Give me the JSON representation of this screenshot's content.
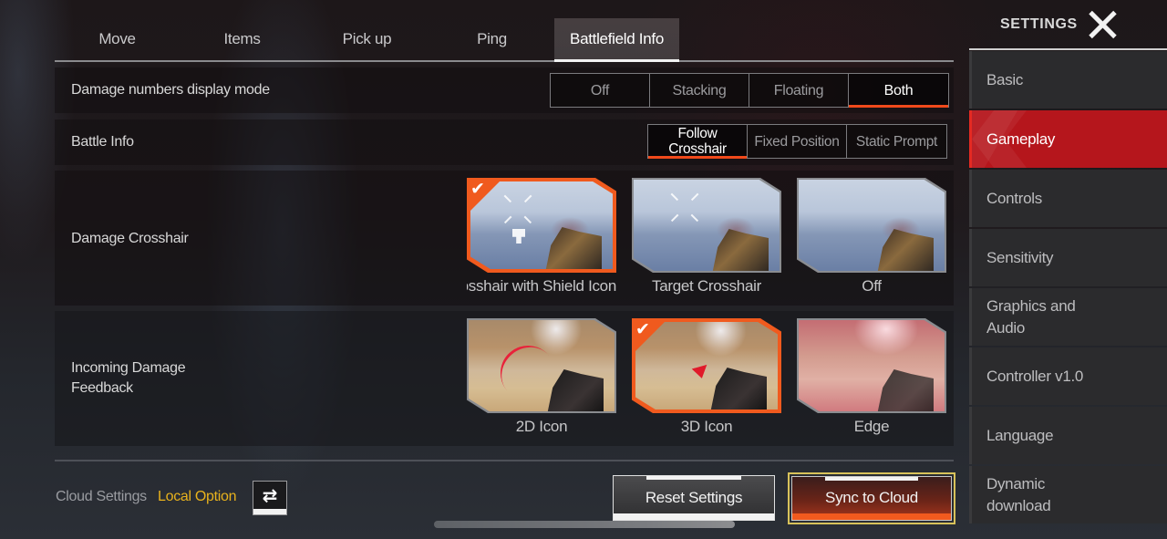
{
  "tabs": [
    {
      "label": "Move",
      "active": false
    },
    {
      "label": "Items",
      "active": false
    },
    {
      "label": "Pick up",
      "active": false
    },
    {
      "label": "Ping",
      "active": false
    },
    {
      "label": "Battlefield Info",
      "active": true
    }
  ],
  "settings": {
    "damage_numbers": {
      "label": "Damage numbers display mode",
      "options": [
        "Off",
        "Stacking",
        "Floating",
        "Both"
      ],
      "selected": "Both"
    },
    "battle_info": {
      "label": "Battle Info",
      "options": [
        "Follow Crosshair",
        "Fixed Position",
        "Static Prompt"
      ],
      "selected": "Follow Crosshair"
    },
    "damage_crosshair": {
      "label": "Damage Crosshair",
      "options": [
        {
          "label": "Crosshair with Shield Icon",
          "visible_label": "rosshair with Shield Ic",
          "selected": true,
          "icon": "check-icon"
        },
        {
          "label": "Target Crosshair",
          "selected": false
        },
        {
          "label": "Off",
          "selected": false
        }
      ]
    },
    "incoming_damage": {
      "label": "Incoming Damage Feedback",
      "label_line1": "Incoming Damage",
      "label_line2": "Feedback",
      "options": [
        {
          "label": "2D Icon",
          "selected": false
        },
        {
          "label": "3D Icon",
          "selected": true,
          "icon": "check-icon"
        },
        {
          "label": "Edge",
          "selected": false
        }
      ]
    }
  },
  "footer": {
    "cloud_settings_label": "Cloud Settings",
    "cloud_settings_value": "Local Option",
    "swap_icon": "swap-arrows-icon",
    "reset_label": "Reset Settings",
    "sync_label": "Sync to Cloud"
  },
  "sidebar": {
    "title": "SETTINGS",
    "close_icon": "close-x-icon",
    "items": [
      {
        "label": "Basic",
        "active": false
      },
      {
        "label": "Gameplay",
        "active": true
      },
      {
        "label": "Controls",
        "active": false
      },
      {
        "label": "Sensitivity",
        "active": false
      },
      {
        "label": "Graphics and Audio",
        "line1": "Graphics and",
        "line2": "Audio",
        "active": false
      },
      {
        "label": "Controller v1.0",
        "active": false
      },
      {
        "label": "Language",
        "active": false
      },
      {
        "label": "Dynamic download",
        "line1": "Dynamic",
        "line2": "download",
        "active": false
      }
    ]
  },
  "colors": {
    "accent_orange": "#f05a1e",
    "active_sidebar_red": "#b5161c",
    "local_option_yellow": "#e8b21d",
    "sync_border_gold": "#d8c25a"
  },
  "icons": {
    "check": "✔",
    "swap": "⇄"
  }
}
